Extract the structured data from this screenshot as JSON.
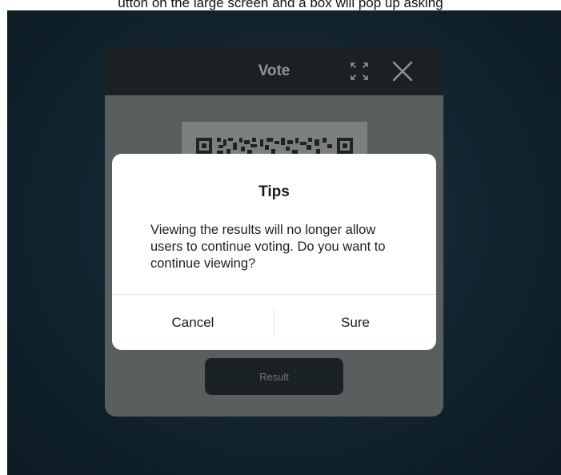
{
  "caption": {
    "text": "utton on the large screen and a box will pop up asking"
  },
  "vote_window": {
    "title": "Vote",
    "expand_icon": "expand-icon",
    "close_icon": "close-icon",
    "result_label": "Result"
  },
  "dialog": {
    "title": "Tips",
    "message": "Viewing the results will no longer allow users to continue voting. Do you want to continue viewing?",
    "cancel_label": "Cancel",
    "sure_label": "Sure"
  },
  "colors": {
    "header_bg": "#1a2024",
    "body_bg": "#595e5f",
    "dialog_bg": "#ffffff",
    "screen_bg": "#142631"
  }
}
